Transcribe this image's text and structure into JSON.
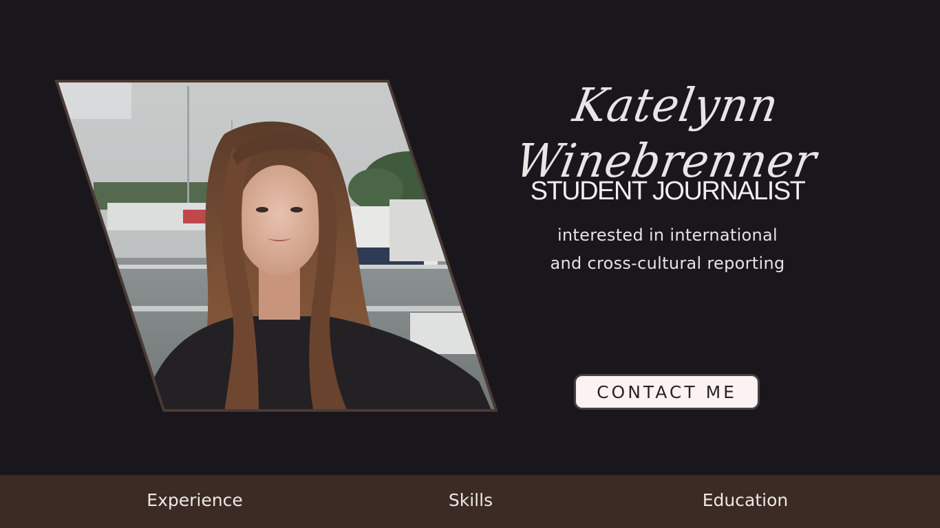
{
  "profile": {
    "name": "Katelynn Winebrenner",
    "title": "STUDENT JOURNALIST",
    "tagline_line1": "interested in international",
    "tagline_line2": "and cross-cultural reporting",
    "contact_label": "CONTACT ME"
  },
  "nav": {
    "items": [
      {
        "label": "Experience"
      },
      {
        "label": "Skills"
      },
      {
        "label": "Education"
      }
    ]
  },
  "colors": {
    "background": "#19171b",
    "footer": "#3b2b24",
    "button_bg": "#fdf2f3",
    "frame": "#4a3a33"
  }
}
